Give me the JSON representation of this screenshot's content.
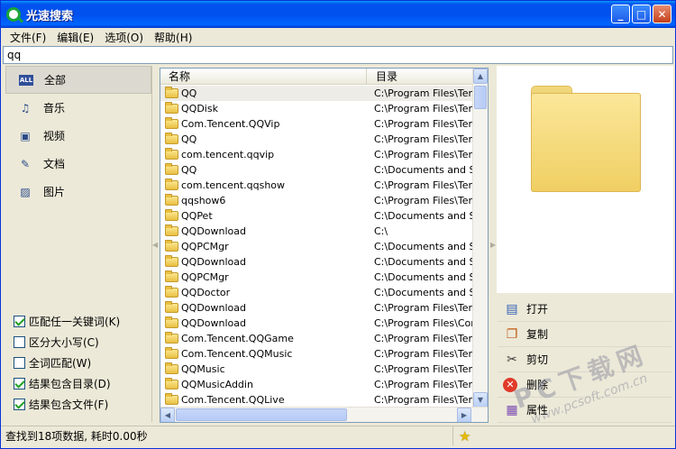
{
  "window": {
    "title": "光速搜索"
  },
  "menu": [
    "文件(F)",
    "编辑(E)",
    "选项(O)",
    "帮助(H)"
  ],
  "search": {
    "value": "qq"
  },
  "categories": [
    {
      "label": "全部",
      "icon": "all-icon"
    },
    {
      "label": "音乐",
      "icon": "music-icon"
    },
    {
      "label": "视频",
      "icon": "video-icon"
    },
    {
      "label": "文档",
      "icon": "document-icon"
    },
    {
      "label": "图片",
      "icon": "image-icon"
    }
  ],
  "options": [
    {
      "label": "匹配任一关键词(K)",
      "checked": true
    },
    {
      "label": "区分大小写(C)",
      "checked": false
    },
    {
      "label": "全词匹配(W)",
      "checked": false
    },
    {
      "label": "结果包含目录(D)",
      "checked": true
    },
    {
      "label": "结果包含文件(F)",
      "checked": true
    }
  ],
  "list": {
    "col_name": "名称",
    "col_dir": "目录",
    "rows": [
      {
        "name": "QQ",
        "dir": "C:\\Program Files\\Tence"
      },
      {
        "name": "QQDisk",
        "dir": "C:\\Program Files\\Tence"
      },
      {
        "name": "Com.Tencent.QQVip",
        "dir": "C:\\Program Files\\Tence"
      },
      {
        "name": "QQ",
        "dir": "C:\\Program Files\\Tence"
      },
      {
        "name": "com.tencent.qqvip",
        "dir": "C:\\Program Files\\Tence"
      },
      {
        "name": "QQ",
        "dir": "C:\\Documents and Sett"
      },
      {
        "name": "com.tencent.qqshow",
        "dir": "C:\\Program Files\\Tence"
      },
      {
        "name": "qqshow6",
        "dir": "C:\\Program Files\\Tence"
      },
      {
        "name": "QQPet",
        "dir": "C:\\Documents and Sett"
      },
      {
        "name": "QQDownload",
        "dir": "C:\\"
      },
      {
        "name": "QQPCMgr",
        "dir": "C:\\Documents and Sett"
      },
      {
        "name": "QQDownload",
        "dir": "C:\\Documents and Sett"
      },
      {
        "name": "QQPCMgr",
        "dir": "C:\\Documents and Sett"
      },
      {
        "name": "QQDoctor",
        "dir": "C:\\Documents and Sett"
      },
      {
        "name": "QQDownload",
        "dir": "C:\\Program Files\\Tence"
      },
      {
        "name": "QQDownload",
        "dir": "C:\\Program Files\\Comm"
      },
      {
        "name": "Com.Tencent.QQGame",
        "dir": "C:\\Program Files\\Tence"
      },
      {
        "name": "Com.Tencent.QQMusic",
        "dir": "C:\\Program Files\\Tence"
      },
      {
        "name": "QQMusic",
        "dir": "C:\\Program Files\\Tence"
      },
      {
        "name": "QQMusicAddin",
        "dir": "C:\\Program Files\\Tence"
      },
      {
        "name": "Com.Tencent.QQLive",
        "dir": "C:\\Program Files\\Tence"
      }
    ]
  },
  "actions": [
    {
      "label": "打开",
      "icon": "open-icon"
    },
    {
      "label": "复制",
      "icon": "copy-icon"
    },
    {
      "label": "剪切",
      "icon": "cut-icon"
    },
    {
      "label": "删除",
      "icon": "delete-icon"
    },
    {
      "label": "属性",
      "icon": "properties-icon"
    }
  ],
  "status": {
    "text": "查找到18项数据, 耗时0.00秒"
  },
  "watermark": {
    "main": "PC下载网",
    "sub": "www.pcsoft.com.cn"
  }
}
